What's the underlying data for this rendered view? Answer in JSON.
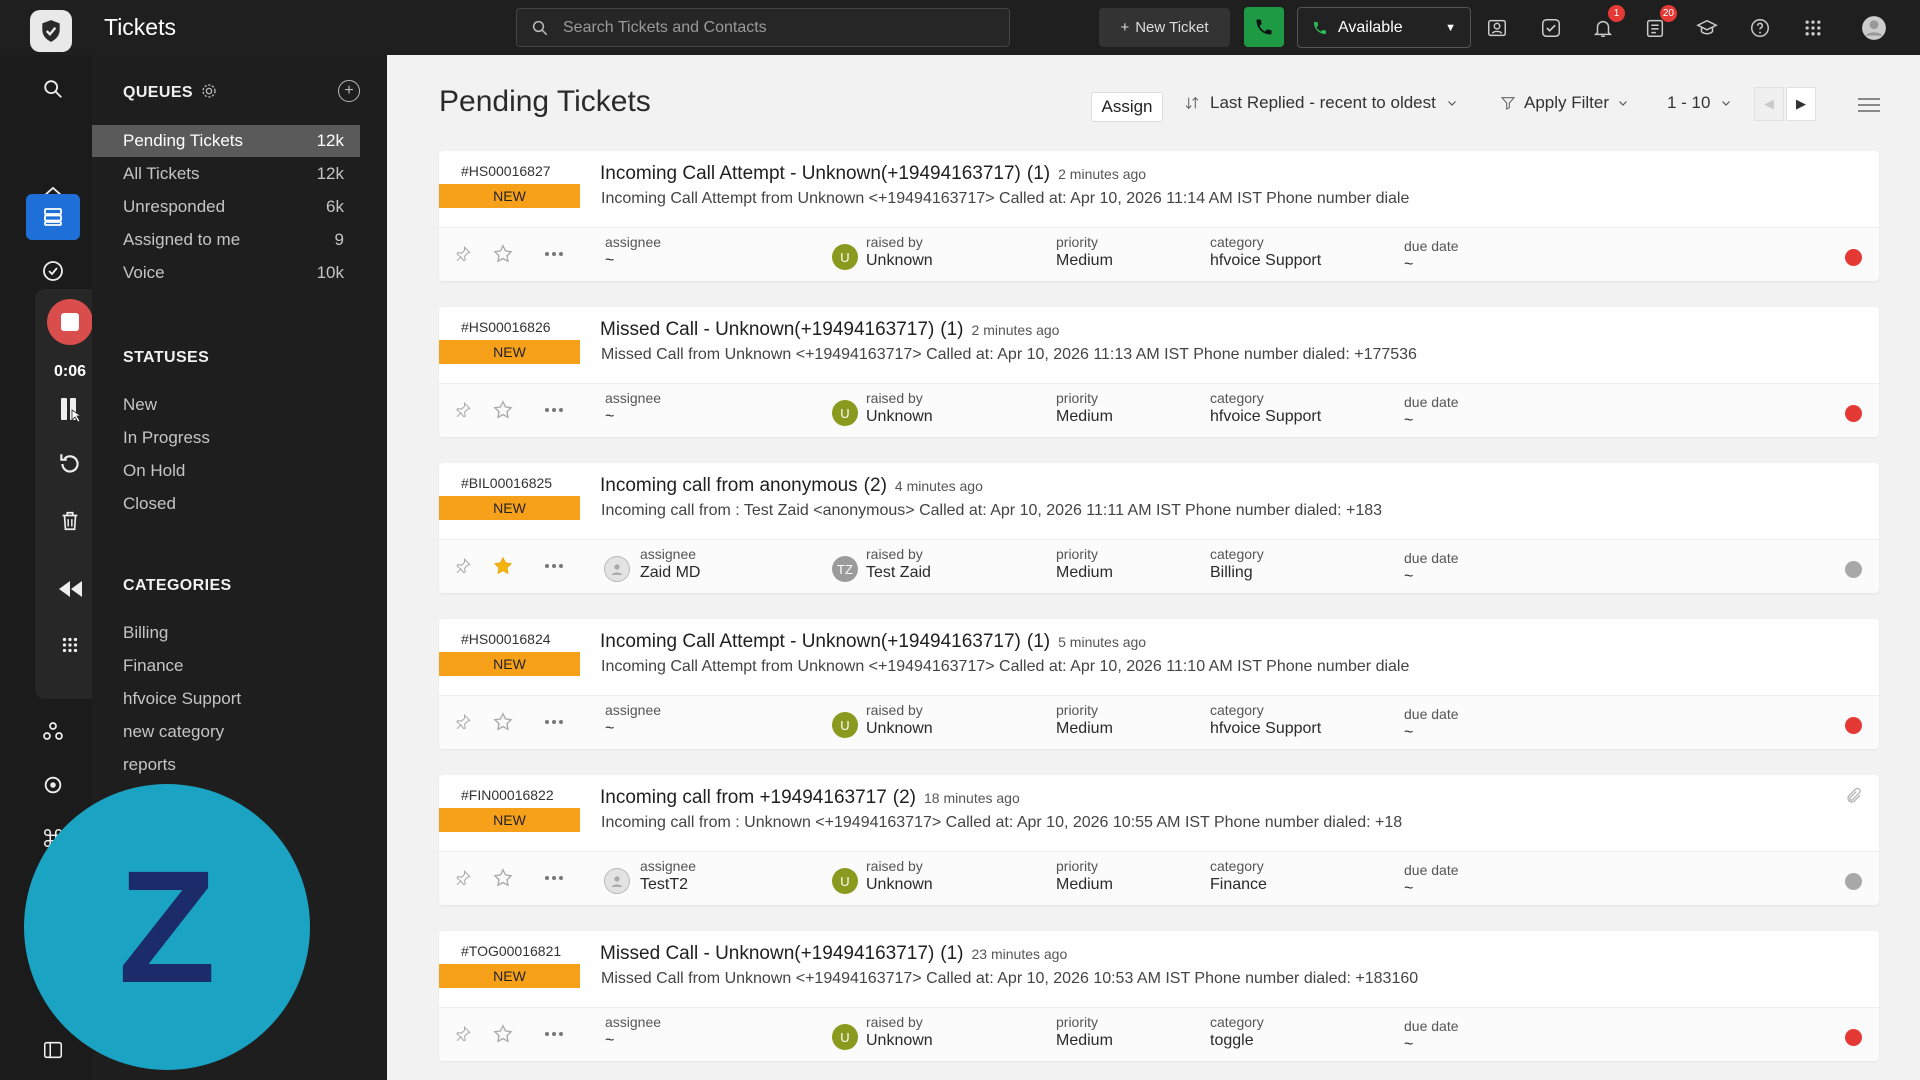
{
  "header": {
    "title": "Tickets",
    "search_placeholder": "Search Tickets and Contacts",
    "new_ticket_label": "New Ticket",
    "status_label": "Available",
    "notifications_count": "1",
    "activities_count": "20"
  },
  "recorder": {
    "time": "0:06"
  },
  "user_avatar_letter": "Z",
  "sidebar": {
    "queues_title": "QUEUES",
    "queues": [
      {
        "label": "Pending Tickets",
        "count": "12k"
      },
      {
        "label": "All Tickets",
        "count": "12k"
      },
      {
        "label": "Unresponded",
        "count": "6k"
      },
      {
        "label": "Assigned to me",
        "count": "9"
      },
      {
        "label": "Voice",
        "count": "10k"
      }
    ],
    "statuses_title": "STATUSES",
    "statuses": [
      "New",
      "In Progress",
      "On Hold",
      "Closed"
    ],
    "categories_title": "CATEGORIES",
    "categories": [
      "Billing",
      "Finance",
      "hfvoice Support",
      "new category",
      "reports"
    ]
  },
  "main": {
    "title": "Pending Tickets",
    "assign_label": "Assign",
    "sort_label": "Last Replied - recent to oldest",
    "filter_label": "Apply Filter",
    "range_label": "1 - 10"
  },
  "labels": {
    "assignee": "assignee",
    "raised_by": "raised by",
    "priority": "priority",
    "category": "category",
    "due_date": "due date"
  },
  "tickets": [
    {
      "id": "#HS00016827",
      "status": "NEW",
      "subject": "Incoming Call Attempt - Unknown(+19494163717)",
      "count": "(1)",
      "ago": "2 minutes ago",
      "preview": "Incoming Call Attempt from Unknown <+19494163717> Called at: Apr 10, 2026 11:14 AM IST Phone number diale",
      "assignee": "~",
      "raised_by": "Unknown",
      "raised_initials": "U",
      "priority": "Medium",
      "category": "hfvoice Support",
      "due": "~",
      "starred": false,
      "dot": "red"
    },
    {
      "id": "#HS00016826",
      "status": "NEW",
      "subject": "Missed Call - Unknown(+19494163717)",
      "count": "(1)",
      "ago": "2 minutes ago",
      "preview": "Missed Call from Unknown <+19494163717> Called at: Apr 10, 2026 11:13 AM IST Phone number dialed: +177536",
      "assignee": "~",
      "raised_by": "Unknown",
      "raised_initials": "U",
      "priority": "Medium",
      "category": "hfvoice Support",
      "due": "~",
      "starred": false,
      "dot": "red"
    },
    {
      "id": "#BIL00016825",
      "status": "NEW",
      "subject": "Incoming call from anonymous",
      "count": "(2)",
      "ago": "4 minutes ago",
      "preview": "Incoming call from : Test Zaid <anonymous> Called at: Apr 10, 2026 11:11 AM IST Phone number dialed: +183",
      "assignee": "Zaid MD",
      "raised_by": "Test Zaid",
      "raised_initials": "TZ",
      "priority": "Medium",
      "category": "Billing",
      "due": "~",
      "starred": true,
      "dot": "gray"
    },
    {
      "id": "#HS00016824",
      "status": "NEW",
      "subject": "Incoming Call Attempt - Unknown(+19494163717)",
      "count": "(1)",
      "ago": "5 minutes ago",
      "preview": "Incoming Call Attempt from Unknown <+19494163717> Called at: Apr 10, 2026 11:10 AM IST Phone number diale",
      "assignee": "~",
      "raised_by": "Unknown",
      "raised_initials": "U",
      "priority": "Medium",
      "category": "hfvoice Support",
      "due": "~",
      "starred": false,
      "dot": "red"
    },
    {
      "id": "#FIN00016822",
      "status": "NEW",
      "subject": "Incoming call from +19494163717",
      "count": "(2)",
      "ago": "18 minutes ago",
      "preview": "Incoming call from : Unknown <+19494163717> Called at: Apr 10, 2026 10:55 AM IST Phone number dialed: +18",
      "assignee": "TestT2",
      "raised_by": "Unknown",
      "raised_initials": "U",
      "priority": "Medium",
      "category": "Finance",
      "due": "~",
      "starred": false,
      "dot": "gray"
    },
    {
      "id": "#TOG00016821",
      "status": "NEW",
      "subject": "Missed Call - Unknown(+19494163717)",
      "count": "(1)",
      "ago": "23 minutes ago",
      "preview": "Missed Call from Unknown <+19494163717> Called at: Apr 10, 2026 10:53 AM IST Phone number dialed: +183160",
      "assignee": "~",
      "raised_by": "Unknown",
      "raised_initials": "U",
      "priority": "Medium",
      "category": "toggle",
      "due": "~",
      "starred": false,
      "dot": "red"
    }
  ]
}
